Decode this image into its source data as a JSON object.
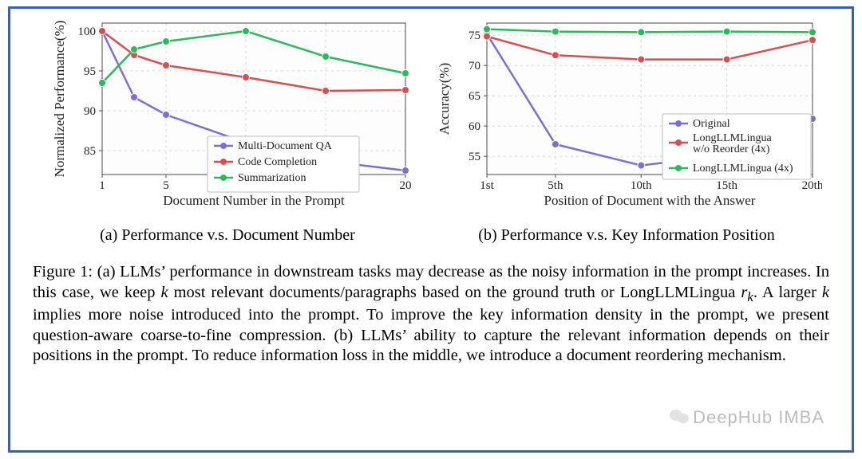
{
  "colors": {
    "purple": "#7d6fd1",
    "red": "#d94e4e",
    "green": "#2eb85c",
    "axis": "#4a4a4a",
    "grid": "#d9d9d9",
    "text": "#222222",
    "frame": "#3761b2"
  },
  "chart_data": [
    {
      "type": "line",
      "title": "",
      "xlabel": "Document Number in the Prompt",
      "ylabel": "Normalized Performance(%)",
      "xTicks": [
        1,
        5,
        10,
        15,
        20
      ],
      "yTicks": [
        85,
        90,
        95,
        100
      ],
      "ylim": [
        82,
        101
      ],
      "xlim": [
        1,
        20
      ],
      "grid": true,
      "legend_pos": "lower-center",
      "series": [
        {
          "name": "Multi-Document QA",
          "color": "purple",
          "x": [
            1,
            3,
            5,
            10,
            15,
            20
          ],
          "y": [
            100,
            91.7,
            89.5,
            86.0,
            83.7,
            82.5
          ]
        },
        {
          "name": "Code Completion",
          "color": "red",
          "x": [
            1,
            3,
            5,
            10,
            15,
            20
          ],
          "y": [
            100,
            97.0,
            95.7,
            94.2,
            92.5,
            92.6
          ]
        },
        {
          "name": "Summarization",
          "color": "green",
          "x": [
            1,
            3,
            5,
            10,
            15,
            20
          ],
          "y": [
            93.5,
            97.7,
            98.7,
            100.0,
            96.8,
            94.7
          ]
        }
      ]
    },
    {
      "type": "line",
      "title": "",
      "xlabel": "Position of Document with the Answer",
      "ylabel": "Accuracy(%)",
      "xTicks": [
        "1st",
        "5th",
        "10th",
        "15th",
        "20th"
      ],
      "xVals": [
        1,
        5,
        10,
        15,
        20
      ],
      "yTicks": [
        55,
        60,
        65,
        70,
        75
      ],
      "ylim": [
        52,
        77
      ],
      "xlim": [
        1,
        20
      ],
      "grid": true,
      "legend_pos": "lower-right",
      "series": [
        {
          "name": "Original",
          "color": "purple",
          "x": [
            1,
            5,
            10,
            15,
            20
          ],
          "y": [
            75.2,
            57.0,
            53.5,
            55.2,
            61.2
          ]
        },
        {
          "name": "LongLLMLingua w/o Reorder (4x)",
          "color": "red",
          "x": [
            1,
            5,
            10,
            15,
            20
          ],
          "y": [
            74.8,
            71.7,
            71.0,
            71.0,
            74.2
          ]
        },
        {
          "name": "LongLLMLingua (4x)",
          "color": "green",
          "x": [
            1,
            5,
            10,
            15,
            20
          ],
          "y": [
            76.0,
            75.6,
            75.5,
            75.6,
            75.5
          ]
        }
      ]
    }
  ],
  "subcaptions": {
    "a": "(a) Performance v.s. Document Number",
    "b": "(b) Performance v.s. Key Information Position"
  },
  "legendA": {
    "items": [
      "Multi-Document QA",
      "Code Completion",
      "Summarization"
    ]
  },
  "legendB": {
    "items": [
      "Original",
      "LongLLMLingua w/o Reorder (4x)",
      "LongLLMLingua (4x)"
    ]
  },
  "caption": {
    "pre": "Figure 1: (a) LLMs’ performance in downstream tasks may decrease as the noisy information in the prompt increases. In this case, we keep ",
    "k1": "k",
    "mid1": " most relevant documents/paragraphs based on the ground truth or LongLLMLingua ",
    "rk": "r",
    "rk_sub": "k",
    "mid2": ". A larger ",
    "k2": "k",
    "post": " implies more noise introduced into the prompt. To improve the key information density in the prompt, we present question-aware coarse-to-fine compression. (b) LLMs’ ability to capture the relevant information depends on their positions in the prompt. To reduce information loss in the middle, we introduce a document reordering mechanism."
  },
  "watermark": "DeepHub IMBA"
}
